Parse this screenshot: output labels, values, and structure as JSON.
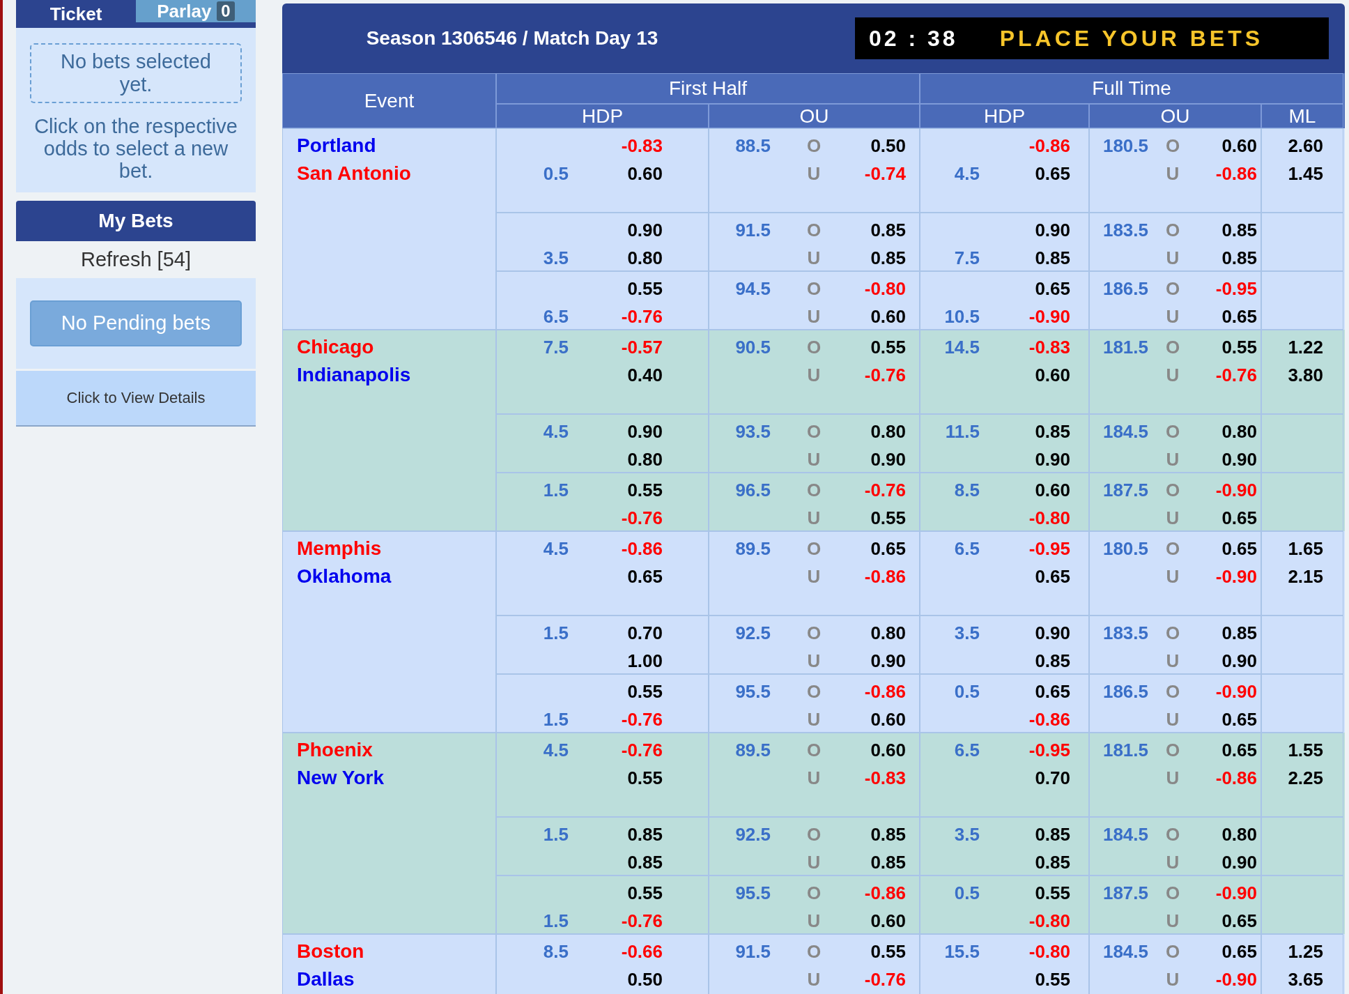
{
  "sidebar": {
    "tabs": [
      {
        "label": "Ticket",
        "selected": true
      },
      {
        "label": "Parlay",
        "badge": "0",
        "selected": false
      }
    ],
    "ticket": {
      "empty_message": "No bets selected yet.",
      "hint": "Click on the respective odds to select a new bet."
    },
    "my_bets": {
      "title": "My Bets",
      "refresh": "Refresh [54]",
      "pending_button": "No Pending bets",
      "details_link": "Click to View Details"
    }
  },
  "header": {
    "title": "Season 1306546 / Match Day 13",
    "timer": "02 : 38",
    "message": "PLACE YOUR BETS"
  },
  "columns": {
    "event": "Event",
    "groups": [
      {
        "label": "First Half",
        "sub": [
          "HDP",
          "OU"
        ]
      },
      {
        "label": "Full Time",
        "sub": [
          "HDP",
          "OU",
          "ML"
        ]
      }
    ]
  },
  "matches": [
    {
      "teams": [
        {
          "name": "Portland",
          "color": "#0000ee"
        },
        {
          "name": "San Antonio",
          "color": "#ff0000"
        }
      ],
      "ml": [
        "2.60",
        "1.45"
      ],
      "blocks": [
        {
          "fh_hdp": {
            "rows": [
              {
                "odds": "-0.83"
              },
              {
                "line": "0.5",
                "odds": "0.60"
              }
            ]
          },
          "fh_ou": {
            "line": "88.5",
            "labels": [
              "O",
              "U"
            ],
            "odds": [
              "0.50",
              "-0.74"
            ]
          },
          "ft_hdp": {
            "rows": [
              {
                "odds": "-0.86"
              },
              {
                "line": "4.5",
                "odds": "0.65"
              }
            ]
          },
          "ft_ou": {
            "line": "180.5",
            "labels": [
              "O",
              "U"
            ],
            "odds": [
              "0.60",
              "-0.86"
            ]
          }
        },
        {
          "fh_hdp": {
            "rows": [
              {
                "odds": "0.90"
              },
              {
                "line": "3.5",
                "odds": "0.80"
              }
            ]
          },
          "fh_ou": {
            "line": "91.5",
            "labels": [
              "O",
              "U"
            ],
            "odds": [
              "0.85",
              "0.85"
            ]
          },
          "ft_hdp": {
            "rows": [
              {
                "odds": "0.90"
              },
              {
                "line": "7.5",
                "odds": "0.85"
              }
            ]
          },
          "ft_ou": {
            "line": "183.5",
            "labels": [
              "O",
              "U"
            ],
            "odds": [
              "0.85",
              "0.85"
            ]
          }
        },
        {
          "fh_hdp": {
            "rows": [
              {
                "odds": "0.55"
              },
              {
                "line": "6.5",
                "odds": "-0.76"
              }
            ]
          },
          "fh_ou": {
            "line": "94.5",
            "labels": [
              "O",
              "U"
            ],
            "odds": [
              "-0.80",
              "0.60"
            ]
          },
          "ft_hdp": {
            "rows": [
              {
                "odds": "0.65"
              },
              {
                "line": "10.5",
                "odds": "-0.90"
              }
            ]
          },
          "ft_ou": {
            "line": "186.5",
            "labels": [
              "O",
              "U"
            ],
            "odds": [
              "-0.95",
              "0.65"
            ]
          }
        }
      ]
    },
    {
      "teams": [
        {
          "name": "Chicago",
          "color": "#ff0000"
        },
        {
          "name": "Indianapolis",
          "color": "#0000ee"
        }
      ],
      "ml": [
        "1.22",
        "3.80"
      ],
      "blocks": [
        {
          "fh_hdp": {
            "rows": [
              {
                "line": "7.5",
                "odds": "-0.57"
              },
              {
                "odds": "0.40"
              }
            ]
          },
          "fh_ou": {
            "line": "90.5",
            "labels": [
              "O",
              "U"
            ],
            "odds": [
              "0.55",
              "-0.76"
            ]
          },
          "ft_hdp": {
            "rows": [
              {
                "line": "14.5",
                "odds": "-0.83"
              },
              {
                "odds": "0.60"
              }
            ]
          },
          "ft_ou": {
            "line": "181.5",
            "labels": [
              "O",
              "U"
            ],
            "odds": [
              "0.55",
              "-0.76"
            ]
          }
        },
        {
          "fh_hdp": {
            "rows": [
              {
                "line": "4.5",
                "odds": "0.90"
              },
              {
                "odds": "0.80"
              }
            ]
          },
          "fh_ou": {
            "line": "93.5",
            "labels": [
              "O",
              "U"
            ],
            "odds": [
              "0.80",
              "0.90"
            ]
          },
          "ft_hdp": {
            "rows": [
              {
                "line": "11.5",
                "odds": "0.85"
              },
              {
                "odds": "0.90"
              }
            ]
          },
          "ft_ou": {
            "line": "184.5",
            "labels": [
              "O",
              "U"
            ],
            "odds": [
              "0.80",
              "0.90"
            ]
          }
        },
        {
          "fh_hdp": {
            "rows": [
              {
                "line": "1.5",
                "odds": "0.55"
              },
              {
                "odds": "-0.76"
              }
            ]
          },
          "fh_ou": {
            "line": "96.5",
            "labels": [
              "O",
              "U"
            ],
            "odds": [
              "-0.76",
              "0.55"
            ]
          },
          "ft_hdp": {
            "rows": [
              {
                "line": "8.5",
                "odds": "0.60"
              },
              {
                "odds": "-0.80"
              }
            ]
          },
          "ft_ou": {
            "line": "187.5",
            "labels": [
              "O",
              "U"
            ],
            "odds": [
              "-0.90",
              "0.65"
            ]
          }
        }
      ]
    },
    {
      "teams": [
        {
          "name": "Memphis",
          "color": "#ff0000"
        },
        {
          "name": "Oklahoma",
          "color": "#0000ee"
        }
      ],
      "ml": [
        "1.65",
        "2.15"
      ],
      "blocks": [
        {
          "fh_hdp": {
            "rows": [
              {
                "line": "4.5",
                "odds": "-0.86"
              },
              {
                "odds": "0.65"
              }
            ]
          },
          "fh_ou": {
            "line": "89.5",
            "labels": [
              "O",
              "U"
            ],
            "odds": [
              "0.65",
              "-0.86"
            ]
          },
          "ft_hdp": {
            "rows": [
              {
                "line": "6.5",
                "odds": "-0.95"
              },
              {
                "odds": "0.65"
              }
            ]
          },
          "ft_ou": {
            "line": "180.5",
            "labels": [
              "O",
              "U"
            ],
            "odds": [
              "0.65",
              "-0.90"
            ]
          }
        },
        {
          "fh_hdp": {
            "rows": [
              {
                "line": "1.5",
                "odds": "0.70"
              },
              {
                "odds": "1.00"
              }
            ]
          },
          "fh_ou": {
            "line": "92.5",
            "labels": [
              "O",
              "U"
            ],
            "odds": [
              "0.80",
              "0.90"
            ]
          },
          "ft_hdp": {
            "rows": [
              {
                "line": "3.5",
                "odds": "0.90"
              },
              {
                "odds": "0.85"
              }
            ]
          },
          "ft_ou": {
            "line": "183.5",
            "labels": [
              "O",
              "U"
            ],
            "odds": [
              "0.85",
              "0.90"
            ]
          }
        },
        {
          "fh_hdp": {
            "rows": [
              {
                "odds": "0.55"
              },
              {
                "line": "1.5",
                "odds": "-0.76"
              }
            ]
          },
          "fh_ou": {
            "line": "95.5",
            "labels": [
              "O",
              "U"
            ],
            "odds": [
              "-0.86",
              "0.60"
            ]
          },
          "ft_hdp": {
            "rows": [
              {
                "line": "0.5",
                "odds": "0.65"
              },
              {
                "odds": "-0.86"
              }
            ]
          },
          "ft_ou": {
            "line": "186.5",
            "labels": [
              "O",
              "U"
            ],
            "odds": [
              "-0.90",
              "0.65"
            ]
          }
        }
      ]
    },
    {
      "teams": [
        {
          "name": "Phoenix",
          "color": "#ff0000"
        },
        {
          "name": "New York",
          "color": "#0000ee"
        }
      ],
      "ml": [
        "1.55",
        "2.25"
      ],
      "blocks": [
        {
          "fh_hdp": {
            "rows": [
              {
                "line": "4.5",
                "odds": "-0.76"
              },
              {
                "odds": "0.55"
              }
            ]
          },
          "fh_ou": {
            "line": "89.5",
            "labels": [
              "O",
              "U"
            ],
            "odds": [
              "0.60",
              "-0.83"
            ]
          },
          "ft_hdp": {
            "rows": [
              {
                "line": "6.5",
                "odds": "-0.95"
              },
              {
                "odds": "0.70"
              }
            ]
          },
          "ft_ou": {
            "line": "181.5",
            "labels": [
              "O",
              "U"
            ],
            "odds": [
              "0.65",
              "-0.86"
            ]
          }
        },
        {
          "fh_hdp": {
            "rows": [
              {
                "line": "1.5",
                "odds": "0.85"
              },
              {
                "odds": "0.85"
              }
            ]
          },
          "fh_ou": {
            "line": "92.5",
            "labels": [
              "O",
              "U"
            ],
            "odds": [
              "0.85",
              "0.85"
            ]
          },
          "ft_hdp": {
            "rows": [
              {
                "line": "3.5",
                "odds": "0.85"
              },
              {
                "odds": "0.85"
              }
            ]
          },
          "ft_ou": {
            "line": "184.5",
            "labels": [
              "O",
              "U"
            ],
            "odds": [
              "0.80",
              "0.90"
            ]
          }
        },
        {
          "fh_hdp": {
            "rows": [
              {
                "odds": "0.55"
              },
              {
                "line": "1.5",
                "odds": "-0.76"
              }
            ]
          },
          "fh_ou": {
            "line": "95.5",
            "labels": [
              "O",
              "U"
            ],
            "odds": [
              "-0.86",
              "0.60"
            ]
          },
          "ft_hdp": {
            "rows": [
              {
                "line": "0.5",
                "odds": "0.55"
              },
              {
                "odds": "-0.80"
              }
            ]
          },
          "ft_ou": {
            "line": "187.5",
            "labels": [
              "O",
              "U"
            ],
            "odds": [
              "-0.90",
              "0.65"
            ]
          }
        }
      ]
    },
    {
      "teams": [
        {
          "name": "Boston",
          "color": "#ff0000"
        },
        {
          "name": "Dallas",
          "color": "#0000ee"
        }
      ],
      "ml": [
        "1.25",
        "3.65"
      ],
      "blocks": [
        {
          "fh_hdp": {
            "rows": [
              {
                "line": "8.5",
                "odds": "-0.66"
              },
              {
                "odds": "0.50"
              }
            ]
          },
          "fh_ou": {
            "line": "91.5",
            "labels": [
              "O",
              "U"
            ],
            "odds": [
              "0.55",
              "-0.76"
            ]
          },
          "ft_hdp": {
            "rows": [
              {
                "line": "15.5",
                "odds": "-0.80"
              },
              {
                "odds": "0.55"
              }
            ]
          },
          "ft_ou": {
            "line": "184.5",
            "labels": [
              "O",
              "U"
            ],
            "odds": [
              "0.65",
              "-0.90"
            ]
          }
        }
      ]
    }
  ]
}
